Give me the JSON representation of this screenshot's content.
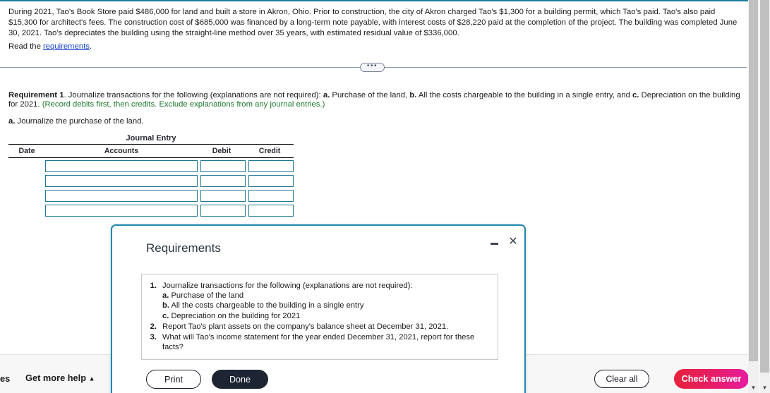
{
  "problem": {
    "paragraph": "During 2021, Tao's Book Store paid $486,000 for land and built a store in Akron, Ohio. Prior to construction, the city of Akron charged Tao's $1,300 for a building permit, which Tao's paid. Tao's also paid $15,300 for architect's fees. The construction cost of $685,000 was financed by a long-term note payable, with interest costs of $28,220 paid at the completion of the project. The building was completed June 30, 2021. Tao's depreciates the building using the straight-line method over 35 years, with estimated residual value of $336,000.",
    "read_prefix": "Read the ",
    "read_link": "requirements",
    "read_suffix": "."
  },
  "splitter": {
    "handle_label": "•••"
  },
  "requirement": {
    "label": "Requirement 1",
    "main": ". Journalize transactions for the following (explanations are not required): ",
    "part_a_bold": "a.",
    "part_a": " Purchase of the land, ",
    "part_b_bold": "b.",
    "part_b": " All the costs chargeable to the building in a single entry, and ",
    "part_c_bold": "c.",
    "part_c": " Depreciation on the building for 2021. ",
    "hint": "(Record debits first, then credits. Exclude explanations from any journal entries.)",
    "sub_a_bold": "a.",
    "sub_a": " Journalize the purchase of the land."
  },
  "journal": {
    "title": "Journal Entry",
    "columns": [
      "Date",
      "Accounts",
      "Debit",
      "Credit"
    ],
    "rows": [
      {
        "date": "",
        "accounts": "",
        "debit": "",
        "credit": ""
      },
      {
        "date": "",
        "accounts": "",
        "debit": "",
        "credit": ""
      },
      {
        "date": "",
        "accounts": "",
        "debit": "",
        "credit": ""
      },
      {
        "date": "",
        "accounts": "",
        "debit": "",
        "credit": ""
      }
    ]
  },
  "dialog": {
    "title": "Requirements",
    "minimize_icon": "minimize-icon",
    "close_icon": "close-icon",
    "items": [
      {
        "num": "1.",
        "text": "Journalize transactions for the following (explanations are not required):",
        "subs": [
          {
            "bold": "a.",
            "text": " Purchase of the land"
          },
          {
            "bold": "b.",
            "text": " All the costs chargeable to the building in a single entry"
          },
          {
            "bold": "c.",
            "text": " Depreciation on the building for 2021"
          }
        ]
      },
      {
        "num": "2.",
        "text": "Report Tao's plant assets on the company's balance sheet at December 31, 2021.",
        "subs": []
      },
      {
        "num": "3.",
        "text": "What will Tao's income statement for the year ended December 31, 2021, report for these facts?",
        "subs": []
      }
    ],
    "print_label": "Print",
    "done_label": "Done"
  },
  "footer": {
    "truncated_text": "es",
    "get_more_help_label": "Get more help",
    "get_more_help_caret": "▲",
    "clear_all_label": "Clear all",
    "check_answer_label": "Check answer"
  },
  "scrollbar": {
    "down_arrow": "▼"
  },
  "colors": {
    "accent_teal": "#1b7ca0",
    "input_border": "#1f7896",
    "hint_green": "#1e7a2e",
    "link_blue": "#1a44cf",
    "check_answer_start": "#e6223c",
    "check_answer_end": "#e81ba0",
    "done_dark": "#1d2433",
    "dialog_border": "#1e88b0"
  }
}
